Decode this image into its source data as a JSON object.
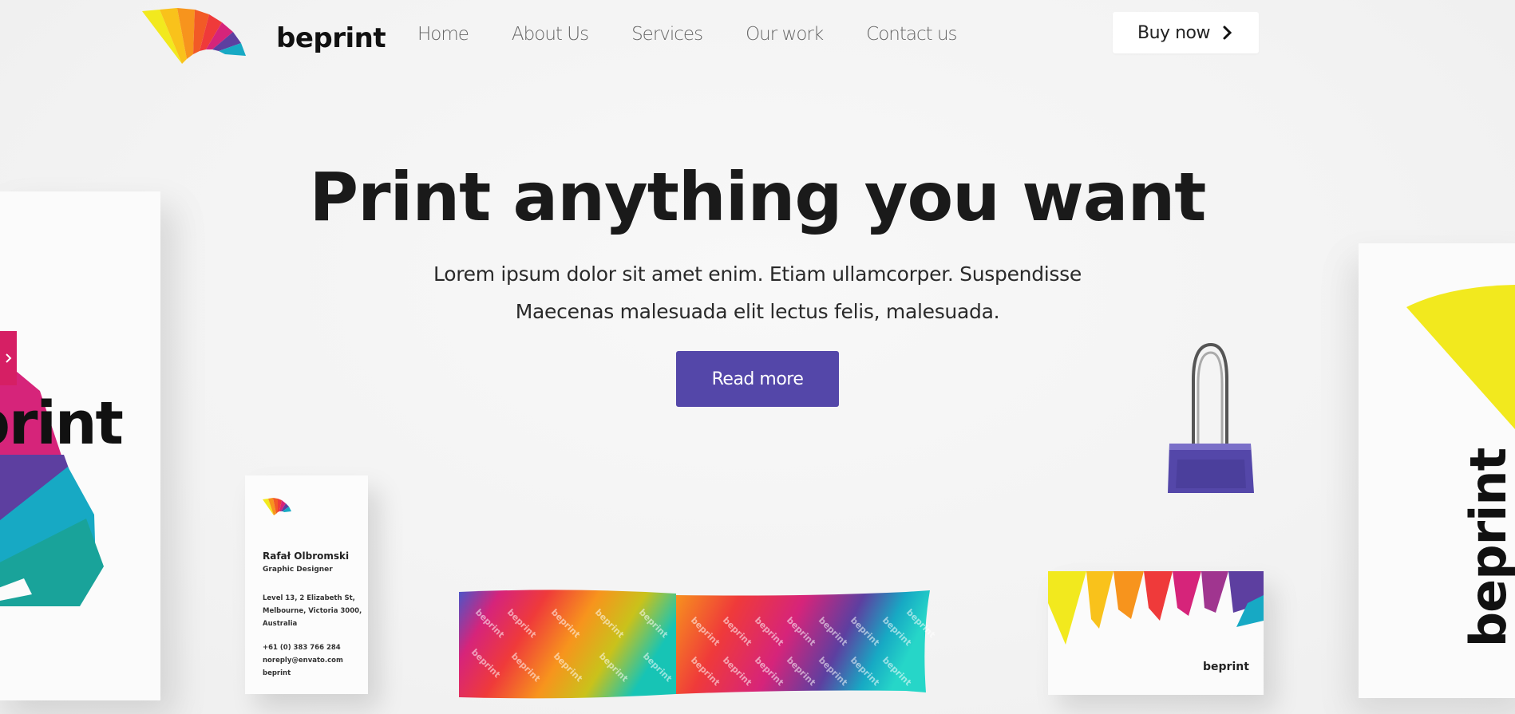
{
  "header": {
    "brand": "beprint",
    "nav": [
      "Home",
      "About Us",
      "Services",
      "Our work",
      "Contact us"
    ],
    "buy_label": "Buy now"
  },
  "hero": {
    "title": "Print anything you want",
    "subtitle_line1": "Lorem ipsum dolor sit amet enim. Etiam ullamcorper. Suspendisse",
    "subtitle_line2": "Maecenas malesuada elit lectus felis, malesuada.",
    "cta": "Read more"
  },
  "mockups": {
    "left_poster_word": "print",
    "business_card": {
      "name": "Rafał Olbromski",
      "role": "Graphic Designer",
      "address_lines": [
        "Level 13, 2 Elizabeth St,",
        "Melbourne, Victoria 3000,",
        "Australia"
      ],
      "phone": "+61 (0) 383 766 284",
      "email": "noreply@envato.com",
      "brand": "beprint"
    },
    "tape_word": "beprint",
    "small_card_word": "beprint",
    "right_poster_word": "beprint"
  },
  "colors": {
    "accent": "#5447a9",
    "side_arrow": "#d61f64",
    "brand_yellow": "#f2e91e",
    "brand_orange": "#f7941d",
    "brand_red": "#ef3a3a",
    "brand_magenta": "#d6247a",
    "brand_purple": "#5d3fa0",
    "brand_teal": "#17a9c4"
  },
  "icons": {
    "buy_chevron": "chevron-right-icon",
    "side_arrow": "chevron-right-icon"
  }
}
